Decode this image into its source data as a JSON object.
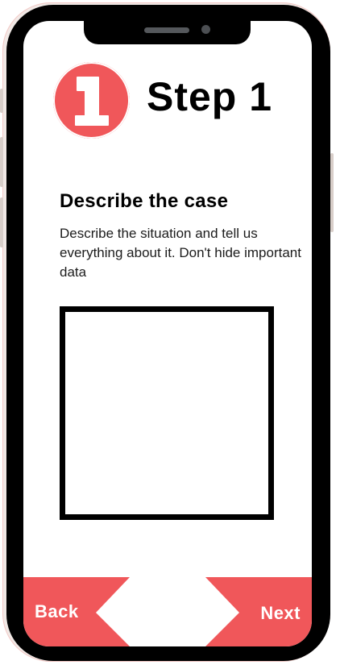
{
  "step": {
    "number": "1",
    "title": "Step 1"
  },
  "section": {
    "heading": "Describe the case",
    "description": "Describe the situation and tell us everything about it. Don't hide important data"
  },
  "description_field": {
    "value": "",
    "placeholder": ""
  },
  "navigation": {
    "back_label": "Back",
    "next_label": "Next"
  },
  "colors": {
    "accent": "#f0575a",
    "frame": "#000000",
    "background": "#ffffff"
  },
  "icons": {
    "step_badge": "number-one-badge-icon"
  }
}
